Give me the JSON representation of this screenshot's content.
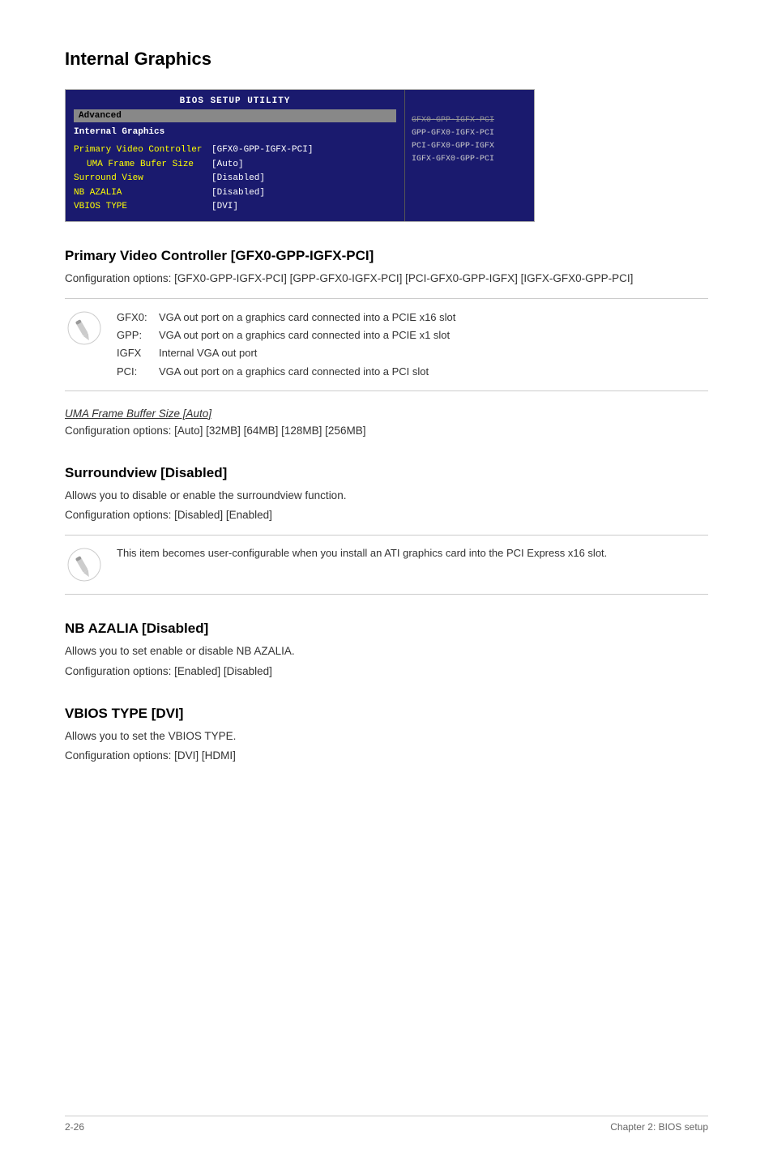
{
  "page": {
    "title": "Internal Graphics",
    "footer_left": "2-26",
    "footer_right": "Chapter 2: BIOS setup"
  },
  "bios": {
    "title_bar": "BIOS SETUP UTILITY",
    "menu_item": "Advanced",
    "section_title": "Internal Graphics",
    "labels": [
      {
        "text": "Primary Video Controller",
        "indent": false
      },
      {
        "text": "UMA Frame Bufer Size",
        "indent": true
      },
      {
        "text": "Surround View",
        "indent": false
      },
      {
        "text": "NB AZALIA",
        "indent": false
      },
      {
        "text": "VBIOS TYPE",
        "indent": false
      }
    ],
    "values": [
      "[GFX0-GPP-IGFX-PCI]",
      "[Auto]",
      "[Disabled]",
      "[Disabled]",
      "[DVI]"
    ],
    "sidebar_options": [
      {
        "text": "GFX0-GPP-IGFX-PCI",
        "strike": true
      },
      {
        "text": "GPP-GFX0-IGFX-PCI",
        "strike": false
      },
      {
        "text": "PCI-GFX0-GPP-IGFX",
        "strike": false
      },
      {
        "text": "IGFX-GFX0-GPP-PCI",
        "strike": false
      }
    ]
  },
  "primary_video": {
    "heading": "Primary Video Controller [GFX0-GPP-IGFX-PCI]",
    "config_text": "Configuration options: [GFX0-GPP-IGFX-PCI] [GPP-GFX0-IGFX-PCI] [PCI-GFX0-GPP-IGFX] [IGFX-GFX0-GPP-PCI]",
    "info_rows": [
      {
        "key": "GFX0:",
        "val": "VGA out port on a graphics card connected into a PCIE x16 slot"
      },
      {
        "key": "GPP:",
        "val": "VGA out port on a graphics card connected into a PCIE x1 slot"
      },
      {
        "key": "IGFX",
        "val": "Internal VGA out port"
      },
      {
        "key": "PCI:",
        "val": "VGA out port on a graphics card connected into a PCI slot"
      }
    ]
  },
  "uma": {
    "title": "UMA Frame Buffer Size [Auto]",
    "config_text": "Configuration options: [Auto] [32MB] [64MB] [128MB] [256MB]"
  },
  "surroundview": {
    "heading": "Surroundview [Disabled]",
    "text1": "Allows you to disable or enable the surroundview function.",
    "text2": "Configuration options: [Disabled] [Enabled]",
    "note": "This item becomes user-configurable when you install an ATI graphics card into the PCI Express x16 slot."
  },
  "nb_azalia": {
    "heading": "NB AZALIA [Disabled]",
    "text1": "Allows you to set enable or disable NB AZALIA.",
    "text2": "Configuration options: [Enabled] [Disabled]"
  },
  "vbios": {
    "heading": "VBIOS TYPE [DVI]",
    "text1": "Allows you to set the VBIOS TYPE.",
    "text2": "Configuration options: [DVI] [HDMI]"
  }
}
